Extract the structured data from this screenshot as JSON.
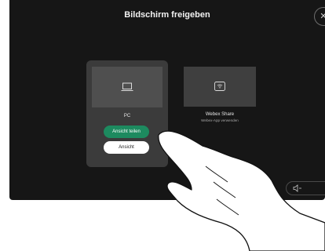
{
  "header": {
    "title": "Bildschirm freigeben",
    "close_icon": "close-icon"
  },
  "sources": [
    {
      "label": "PC",
      "icon": "laptop-icon",
      "primary_button": "Ansicht teilen",
      "secondary_button": "Ansicht"
    },
    {
      "label": "Webex Share",
      "sublabel": "Webex-App verwenden",
      "icon": "wireless-share-icon"
    }
  ],
  "volume": {
    "down_icon": "volume-down-icon",
    "up_icon": "volume-up-icon"
  },
  "colors": {
    "screen_bg": "#161616",
    "card_bg": "#3b3b3b",
    "accent_green": "#1d8a5f"
  }
}
